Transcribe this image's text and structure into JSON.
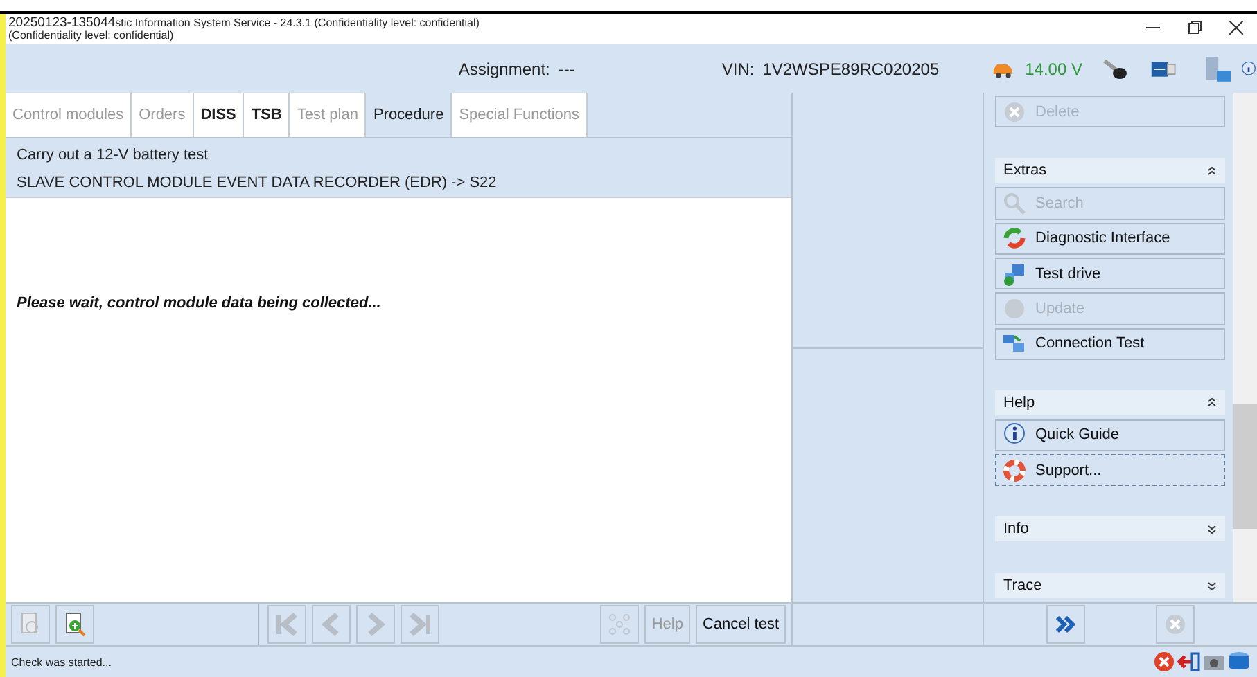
{
  "window": {
    "title_prefix": "20250123-135044",
    "title": "stic Information System Service - 24.3.1 (Confidentiality level: confidential)",
    "subtitle": "(Confidentiality level: confidential)"
  },
  "header": {
    "assignment_label": "Assignment:",
    "assignment_value": "---",
    "vin_label": "VIN:",
    "vin_value": "1V2WSPE89RC020205",
    "voltage": "14.00 V"
  },
  "tabs": [
    {
      "label": "Control modules",
      "selected": false,
      "disabled": true,
      "bold": false
    },
    {
      "label": "Orders",
      "selected": false,
      "disabled": true,
      "bold": false
    },
    {
      "label": "DISS",
      "selected": false,
      "disabled": false,
      "bold": true
    },
    {
      "label": "TSB",
      "selected": false,
      "disabled": false,
      "bold": true
    },
    {
      "label": "Test plan",
      "selected": false,
      "disabled": true,
      "bold": false
    },
    {
      "label": "Procedure",
      "selected": true,
      "disabled": false,
      "bold": false
    },
    {
      "label": "Special Functions",
      "selected": false,
      "disabled": true,
      "bold": false
    }
  ],
  "procedure": {
    "lines": [
      "Carry out a 12-V battery test",
      "SLAVE CONTROL MODULE EVENT DATA RECORDER (EDR) -> S22"
    ],
    "message": "Please wait, control module data being collected..."
  },
  "toolbar": {
    "help": {
      "label": "Help",
      "disabled": true
    },
    "cancel": {
      "label": "Cancel test",
      "disabled": false
    }
  },
  "sidebar": {
    "delete": {
      "label": "Delete",
      "disabled": true
    },
    "sections": [
      {
        "title": "Extras",
        "expanded": true,
        "items": [
          {
            "label": "Search",
            "kind": "search",
            "disabled": true,
            "focused": false
          },
          {
            "label": "Diagnostic Interface",
            "kind": "interface",
            "disabled": false,
            "focused": false
          },
          {
            "label": "Test drive",
            "kind": "drive",
            "disabled": false,
            "focused": false
          },
          {
            "label": "Update",
            "kind": "update",
            "disabled": true,
            "focused": false
          },
          {
            "label": "Connection Test",
            "kind": "connection",
            "disabled": false,
            "focused": false
          }
        ]
      },
      {
        "title": "Help",
        "expanded": true,
        "items": [
          {
            "label": "Quick Guide",
            "kind": "info",
            "disabled": false,
            "focused": false
          },
          {
            "label": "Support...",
            "kind": "support",
            "disabled": false,
            "focused": true
          }
        ]
      },
      {
        "title": "Info",
        "expanded": false
      },
      {
        "title": "Trace",
        "expanded": false
      }
    ]
  },
  "status_bar": {
    "text": "Check was started..."
  }
}
